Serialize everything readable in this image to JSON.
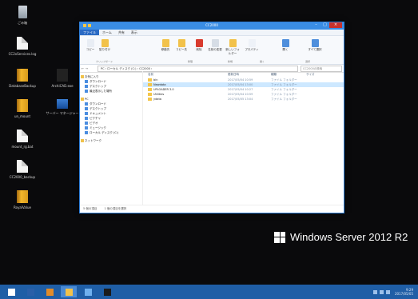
{
  "desktop": {
    "icons": [
      {
        "label": "ごみ箱",
        "kind": "bin"
      },
      {
        "label": "CC2xServices.log",
        "kind": "file"
      },
      {
        "label": "DatabaseBackup",
        "kind": "book"
      },
      {
        "label": "ArchiCAD.exe",
        "kind": "arch"
      },
      {
        "label": "un_mount",
        "kind": "book"
      },
      {
        "label": "サーバー マネージャー",
        "kind": "lap"
      },
      {
        "label": "mount_rg.bat",
        "kind": "file"
      },
      {
        "label": "CC2000_backup",
        "kind": "file"
      },
      {
        "label": "RoyalValue",
        "kind": "book"
      }
    ]
  },
  "explorer": {
    "title": "CC2000",
    "ribbon_tabs": [
      "ファイル",
      "ホーム",
      "共有",
      "表示"
    ],
    "ribbon_buttons": [
      "コピー",
      "貼り付け",
      "移動先",
      "コピー先",
      "削除",
      "名前の変更",
      "新しいフォルダー",
      "プロパティ",
      "開く",
      "すべて選択"
    ],
    "ribbon_groups": [
      "クリップボード",
      "整理",
      "新規",
      "開く",
      "選択"
    ],
    "address": {
      "path": "PC › ローカル ディスク (C:) › CC2000 ›",
      "search_placeholder": "CC2000の検索"
    },
    "nav": {
      "back": "←",
      "forward": "→"
    },
    "nav_pane": [
      {
        "label": "お気に入り",
        "top": true
      },
      {
        "label": "ダウンロード",
        "top": false
      },
      {
        "label": "デスクトップ",
        "top": false
      },
      {
        "label": "最近表示した場所",
        "top": false
      },
      {
        "label": "PC",
        "top": true
      },
      {
        "label": "ダウンロード",
        "top": false
      },
      {
        "label": "デスクトップ",
        "top": false
      },
      {
        "label": "ドキュメント",
        "top": false
      },
      {
        "label": "ピクチャ",
        "top": false
      },
      {
        "label": "ビデオ",
        "top": false
      },
      {
        "label": "ミュージック",
        "top": false
      },
      {
        "label": "ローカル ディスク (C:)",
        "top": false
      },
      {
        "label": "ネットワーク",
        "top": true
      }
    ],
    "columns": [
      "名前",
      "更新日時",
      "種類",
      "サイズ"
    ],
    "rows": [
      {
        "name": "bin",
        "date": "2017/05/04 10:59",
        "type": "ファイル フォルダー"
      },
      {
        "name": "Newdata",
        "date": "2017/05/04 13:00",
        "type": "ファイル フォルダー"
      },
      {
        "name": "UPLOADER 3.0",
        "date": "2017/05/04 10:27",
        "type": "ファイル フォルダー"
      },
      {
        "name": "Utilities",
        "date": "2017/05/04 10:59",
        "type": "ファイル フォルダー"
      },
      {
        "name": "ydata",
        "date": "2017/05/05 13:04",
        "type": "ファイル フォルダー"
      }
    ],
    "status": [
      "5 個の項目",
      "1 個の項目を選択"
    ]
  },
  "branding": {
    "text": "Windows Server 2012 R2"
  },
  "taskbar": {
    "buttons": [
      "start",
      "powershell",
      "server-manager",
      "explorer",
      "ie",
      "cmd"
    ],
    "clock_time": "9:29",
    "clock_date": "2017/05/05"
  },
  "colors": {
    "taskbar": "#1f5ea6",
    "window_title": "#3a8de4",
    "close": "#c8312b",
    "desktop": "#0a0a0c"
  }
}
